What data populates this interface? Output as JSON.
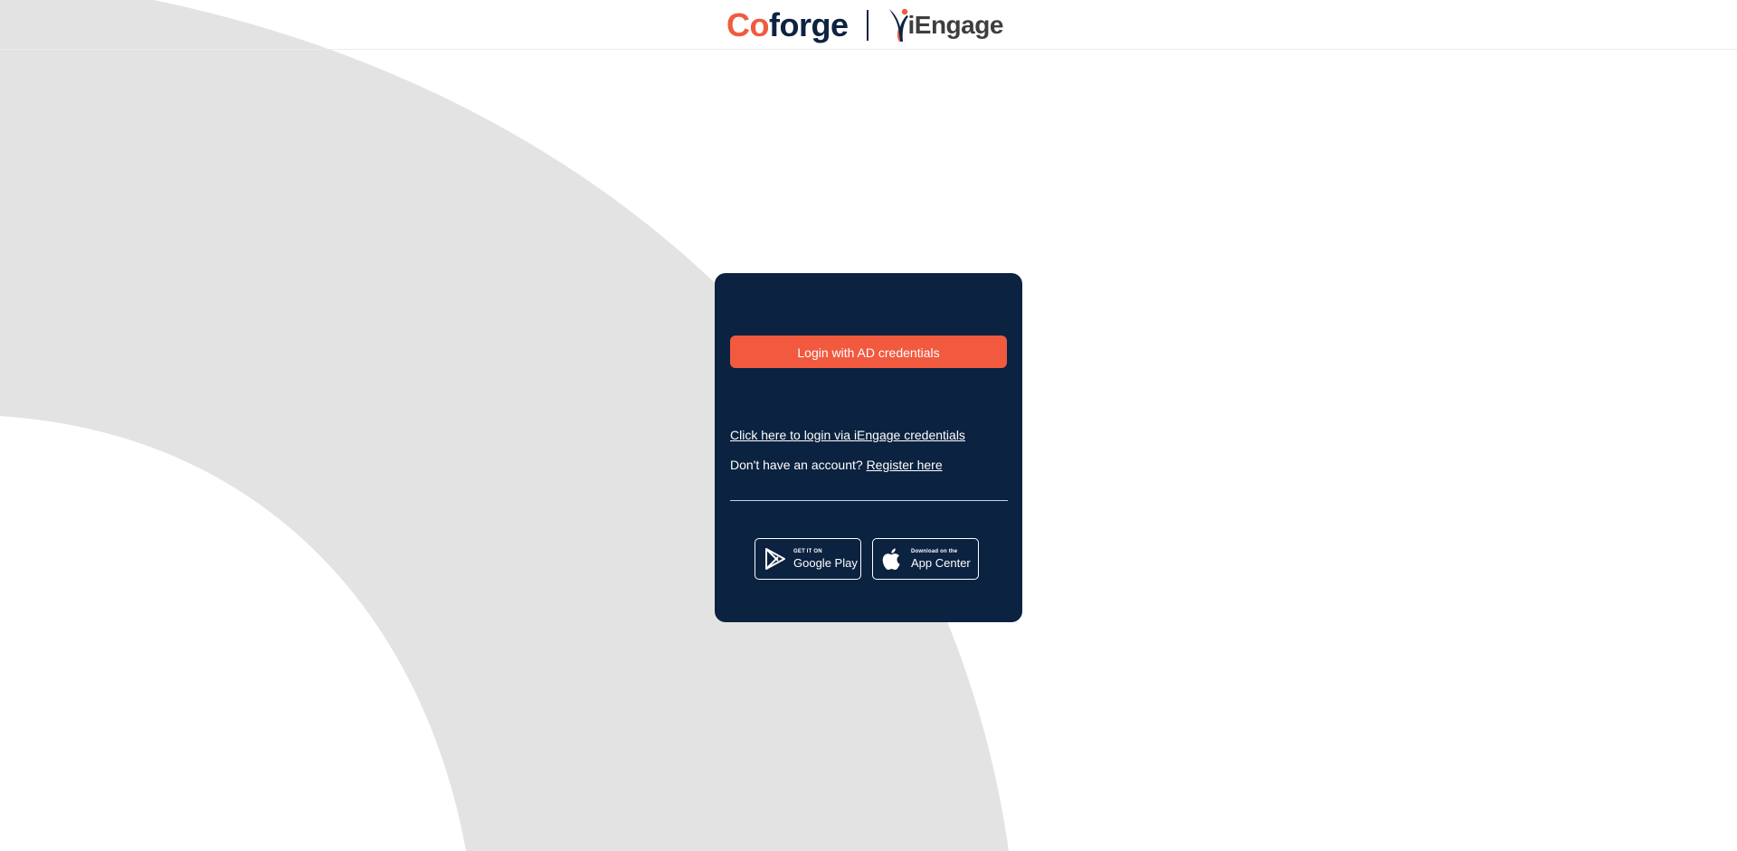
{
  "header": {
    "coforge_logo": {
      "first_letter": "C",
      "second_letter": "o",
      "rest": "forge"
    },
    "iengage_logo": {
      "text": "iEngage"
    }
  },
  "colors": {
    "brand_orange": "#f15a3f",
    "brand_navy": "#0b2240",
    "background_arc": "#e3e3e3",
    "logo_text_grey": "#3e3e3e"
  },
  "login_card": {
    "ad_button_label": "Login with AD credentials",
    "iengage_link_label": "Click here to login via iEngage credentials",
    "register_prompt": "Don't have an account?",
    "register_link_label": "Register here"
  },
  "store_badges": {
    "google_play": {
      "small": "GET IT ON",
      "big": "Google Play",
      "icon": "google-play-icon"
    },
    "app_center": {
      "small": "Download on the",
      "big": "App Center",
      "icon": "apple-icon"
    }
  }
}
